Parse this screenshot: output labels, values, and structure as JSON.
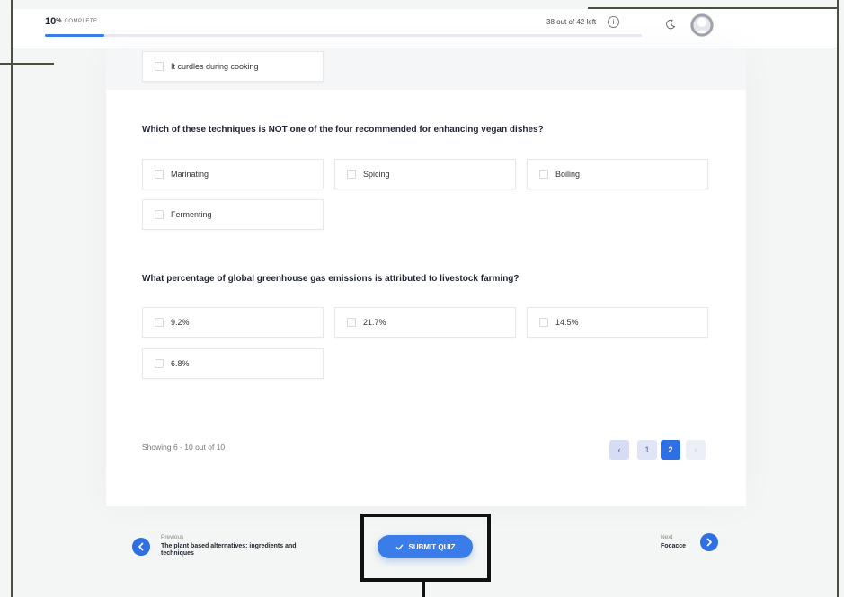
{
  "header": {
    "progress_value": "10",
    "progress_unit": "%",
    "progress_label": "COMPLETE",
    "progress_fraction": 0.1,
    "questions_left": "38 out of 42 left",
    "info_glyph": "i",
    "icons": [
      "info-icon",
      "moon-icon",
      "avatar"
    ]
  },
  "quiz": {
    "prev_option": "It curdles during cooking",
    "questions": [
      {
        "text": "Which of these techniques is NOT one of the four recommended for enhancing vegan dishes?",
        "options": [
          "Marinating",
          "Spicing",
          "Boiling",
          "Fermenting"
        ]
      },
      {
        "text": "What percentage of global greenhouse gas emissions is attributed to livestock farming?",
        "options": [
          "9.2%",
          "21.7%",
          "14.5%",
          "6.8%"
        ]
      }
    ],
    "showing": "Showing 6 - 10 out of 10",
    "pages": [
      "1",
      "2"
    ],
    "current_page": "2",
    "prev_glyph": "‹",
    "next_glyph": "›"
  },
  "footer": {
    "previous_label": "Previous",
    "previous_title": "The plant based alternatives: ingredients and techniques",
    "submit_label": "SUBMIT QUIZ",
    "next_label": "Next",
    "next_title": "Focacce"
  },
  "colors": {
    "accent": "#2f6fe4",
    "background": "#f3f6f4",
    "frame": "#4a4f3f"
  }
}
